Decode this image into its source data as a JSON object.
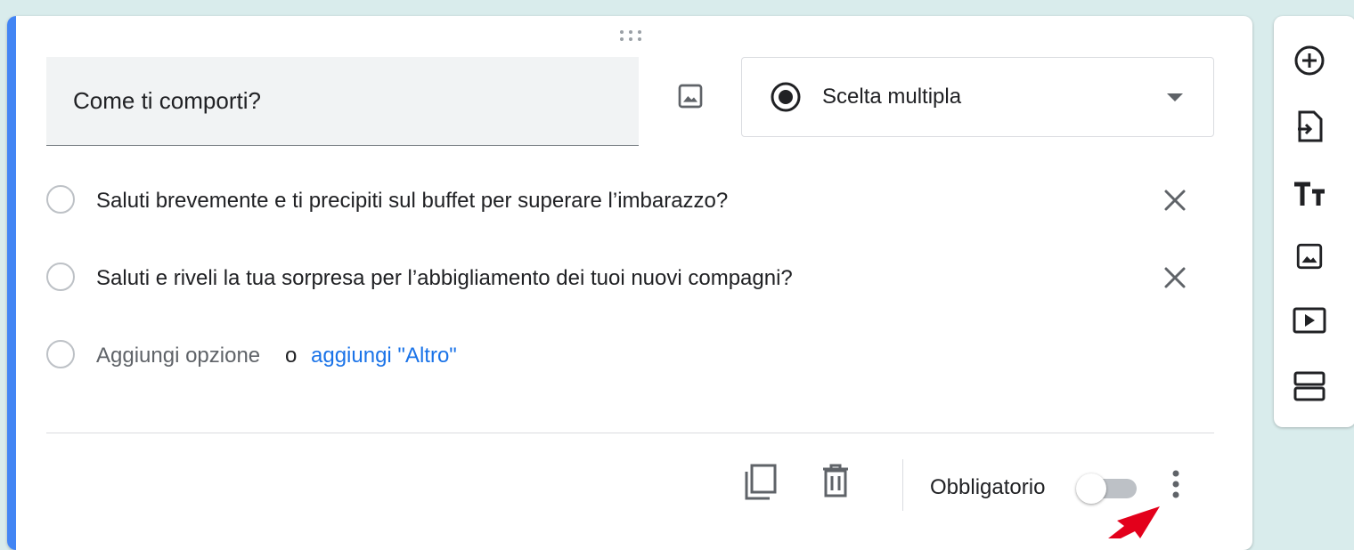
{
  "question": {
    "title": "Come ti comporti?",
    "type_label": "Scelta multipla"
  },
  "options": [
    {
      "label": "Saluti brevemente e ti precipiti sul buffet per superare l’imbarazzo?"
    },
    {
      "label": "Saluti e riveli la tua sorpresa per l’abbigliamento dei tuoi nuovi compagni?"
    }
  ],
  "add_option": {
    "label": "Aggiungi opzione",
    "or": "o",
    "other_label": "aggiungi \"Altro\""
  },
  "footer": {
    "required_label": "Obbligatorio",
    "required_on": false
  },
  "toolbar": {
    "items": [
      "add-question-icon",
      "import-questions-icon",
      "add-title-icon",
      "add-image-icon",
      "add-video-icon",
      "add-section-icon"
    ]
  },
  "colors": {
    "accent": "#4285f4",
    "link": "#1a73e8",
    "background": "#d9ecec",
    "annotation_arrow": "#e3001b"
  }
}
